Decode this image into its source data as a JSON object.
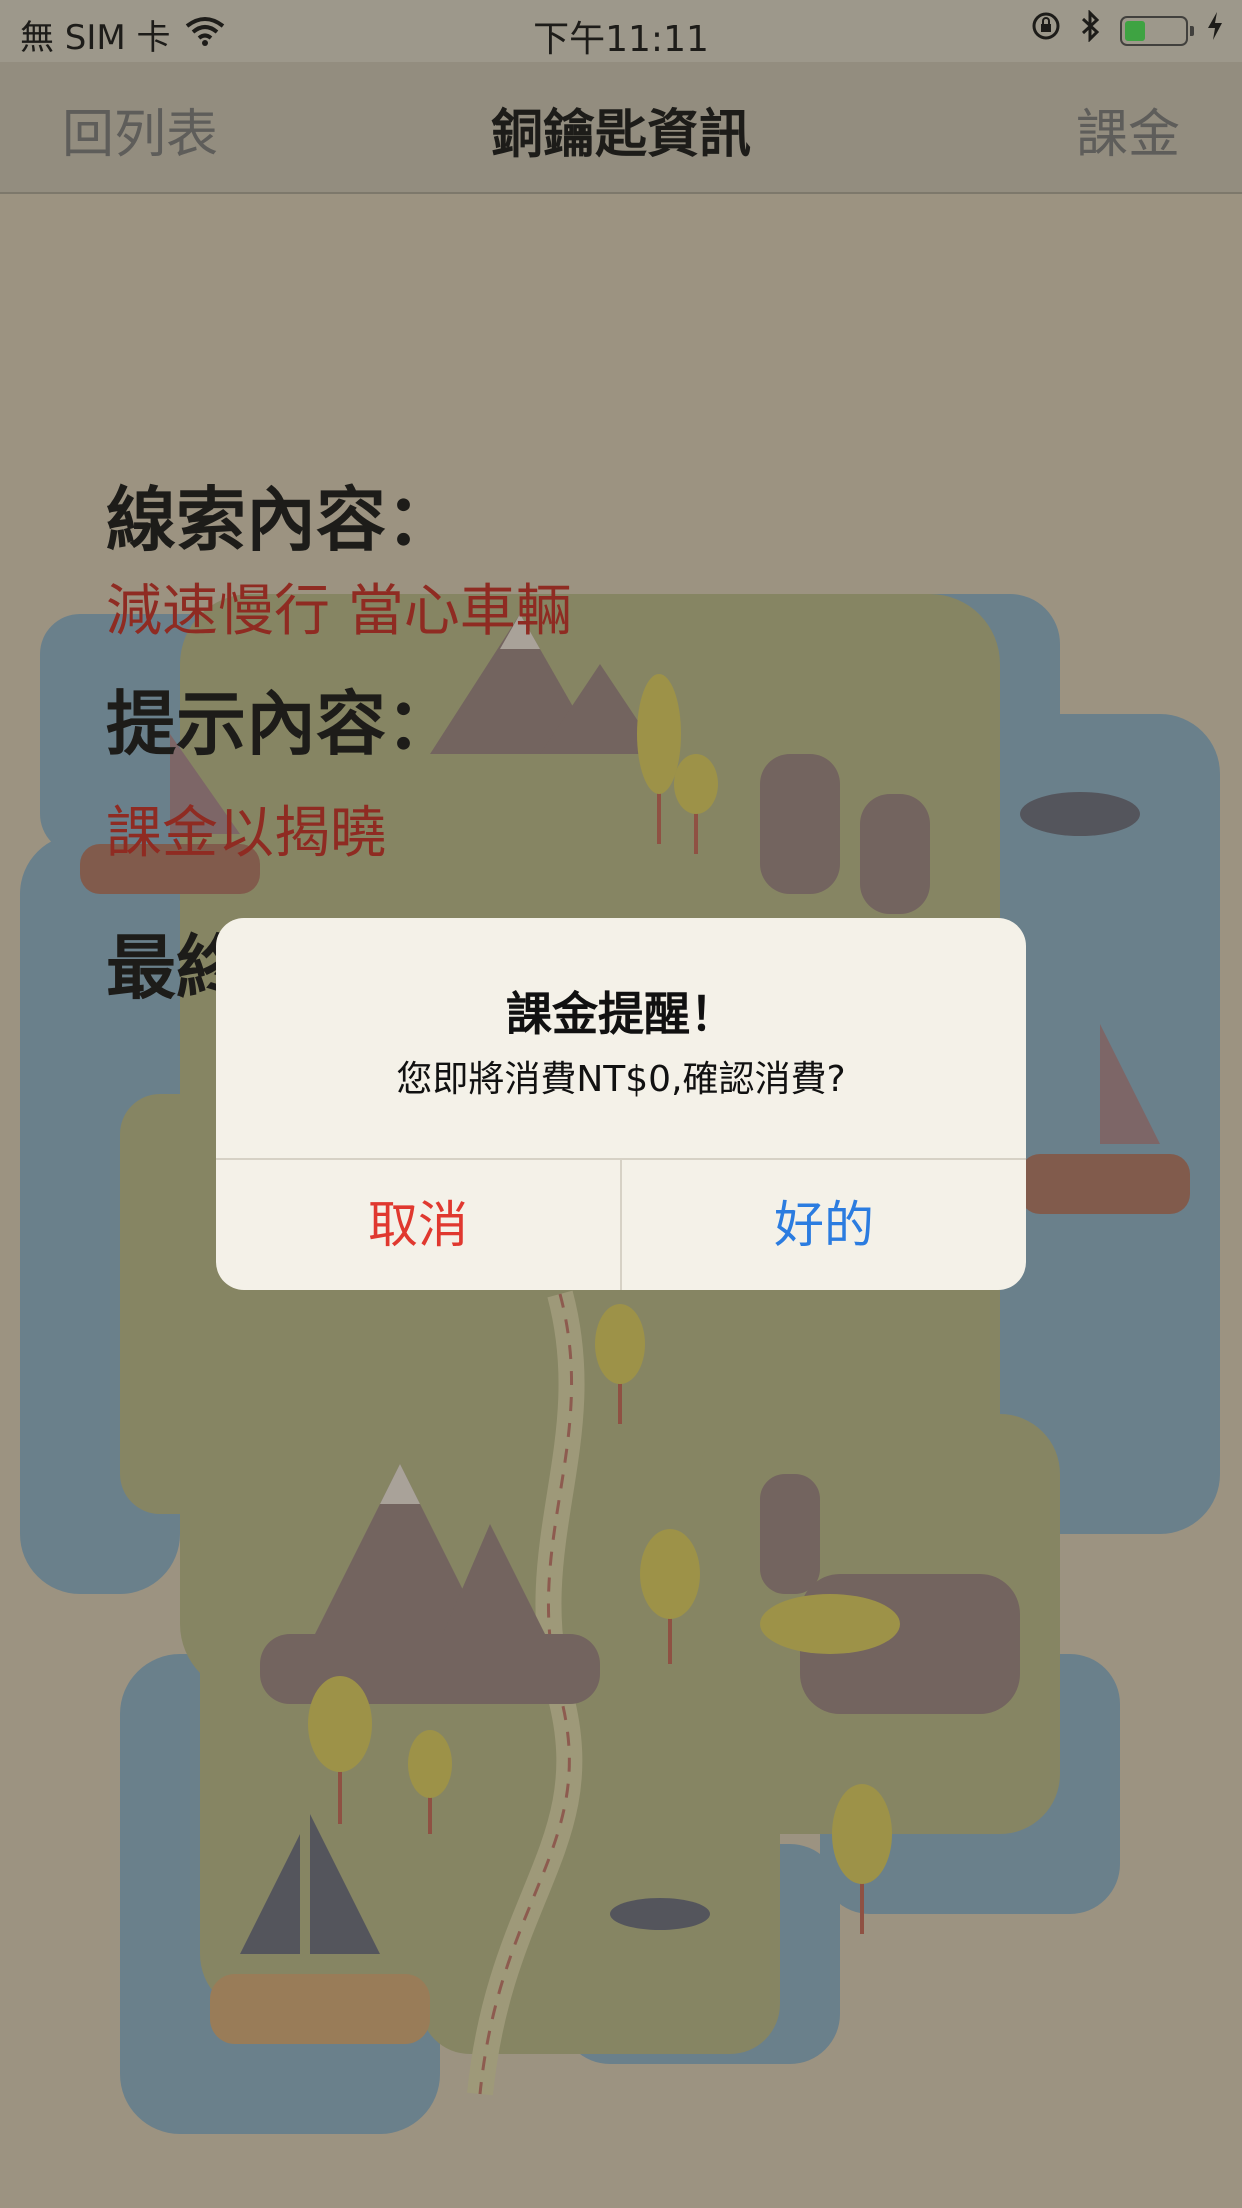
{
  "status_bar": {
    "carrier": "無 SIM 卡",
    "time": "下午11:11",
    "battery_level": 0.35,
    "icons": [
      "wifi-icon",
      "rotation-lock-icon",
      "bluetooth-icon",
      "battery-icon",
      "charging-icon"
    ]
  },
  "nav": {
    "back_label": "回列表",
    "title": "銅鑰匙資訊",
    "pay_label": "課金"
  },
  "content": {
    "clue_heading": "線索內容：",
    "clue_text": "減速慢行 當心車輛",
    "hint_heading": "提示內容：",
    "hint_text": "課金以揭曉",
    "final_heading_partial": "最終"
  },
  "alert": {
    "title": "課金提醒！",
    "message": "您即將消費NT$0,確認消費?",
    "cancel_label": "取消",
    "ok_label": "好的"
  },
  "colors": {
    "accent_red": "#b3261e",
    "cancel_red": "#e0382f",
    "ok_blue": "#2b7ce0"
  }
}
